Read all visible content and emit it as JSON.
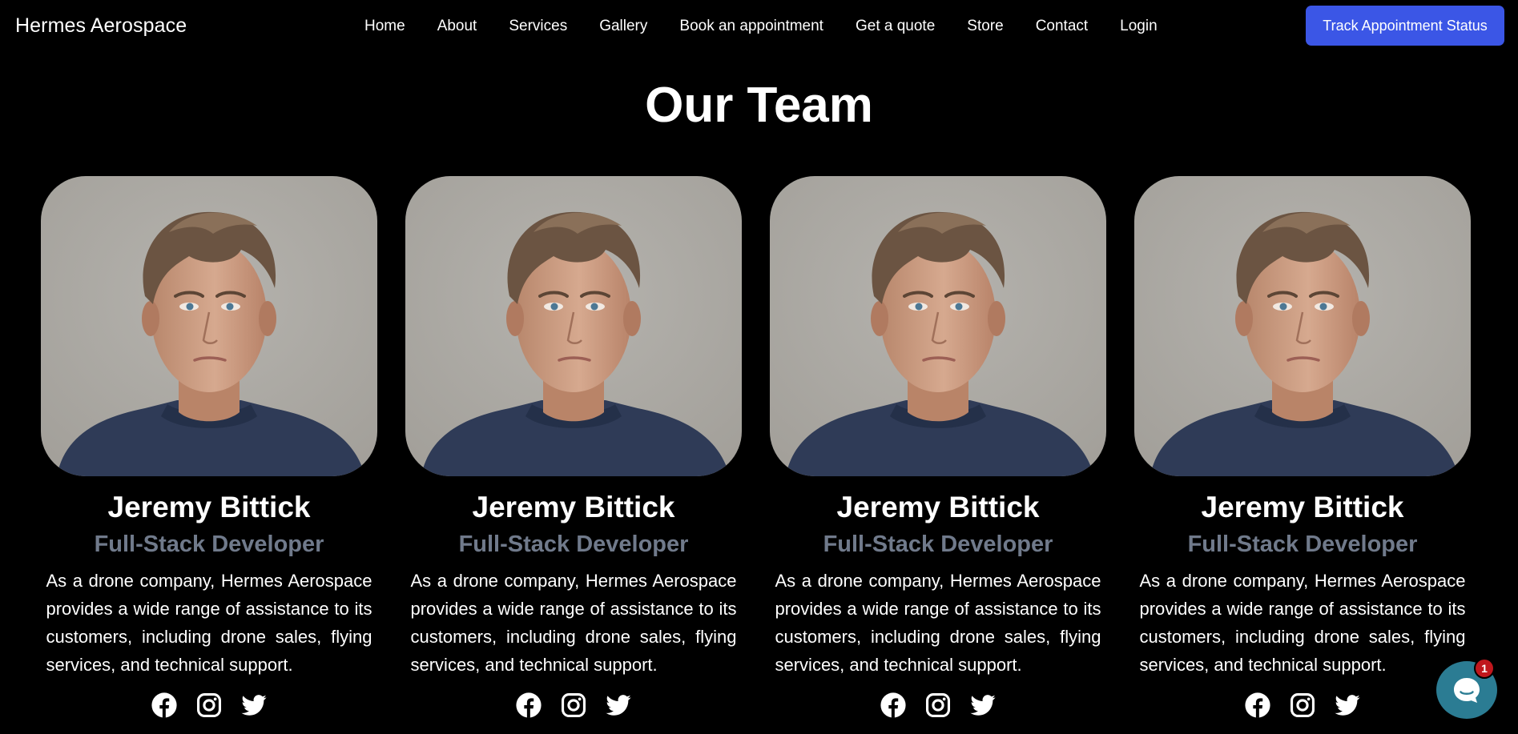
{
  "brand": "Hermes Aerospace",
  "nav": [
    "Home",
    "About",
    "Services",
    "Gallery",
    "Book an appointment",
    "Get a quote",
    "Store",
    "Contact",
    "Login"
  ],
  "track_button": "Track Appointment Status",
  "section_title": "Our Team",
  "team": [
    {
      "name": "Jeremy Bittick",
      "role": "Full-Stack Developer",
      "bio": "As a drone company, Hermes Aerospace provides a wide range of assistance to its customers, including drone sales, flying services, and technical support."
    },
    {
      "name": "Jeremy Bittick",
      "role": "Full-Stack Developer",
      "bio": "As a drone company, Hermes Aerospace provides a wide range of assistance to its customers, including drone sales, flying services, and technical support."
    },
    {
      "name": "Jeremy Bittick",
      "role": "Full-Stack Developer",
      "bio": "As a drone company, Hermes Aerospace provides a wide range of assistance to its customers, including drone sales, flying services, and technical support."
    },
    {
      "name": "Jeremy Bittick",
      "role": "Full-Stack Developer",
      "bio": "As a drone company, Hermes Aerospace provides a wide range of assistance to its customers, including drone sales, flying services, and technical support."
    }
  ],
  "socials": [
    "facebook-icon",
    "instagram-icon",
    "twitter-icon"
  ],
  "chat": {
    "badge_count": "1",
    "icon": "chat-bubble-icon"
  },
  "colors": {
    "background": "#000000",
    "accent": "#3b56e6",
    "role_text": "#707a8b",
    "chat": "#2b7c93",
    "badge": "#c0171d"
  }
}
